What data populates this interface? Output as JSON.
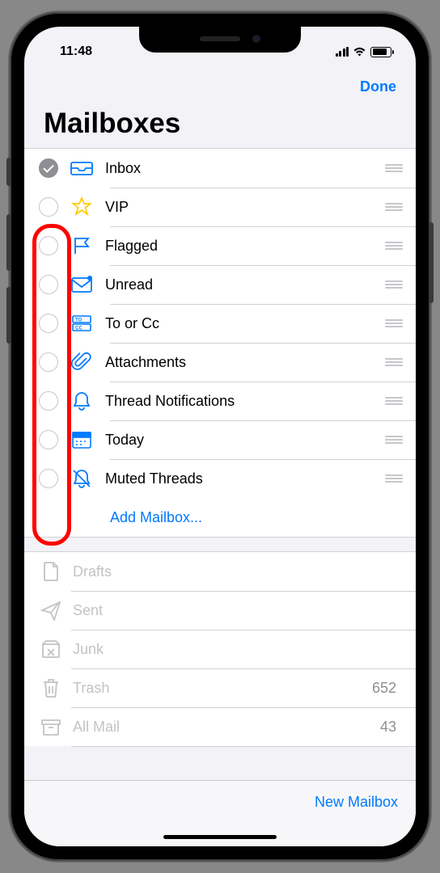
{
  "status": {
    "time": "11:48"
  },
  "nav": {
    "done": "Done"
  },
  "title": "Mailboxes",
  "smart_mailboxes": [
    {
      "id": "inbox",
      "label": "Inbox",
      "icon": "tray-icon",
      "checked": true,
      "color": "#007aff"
    },
    {
      "id": "vip",
      "label": "VIP",
      "icon": "star-icon",
      "checked": false,
      "color": "#ffcc00"
    },
    {
      "id": "flagged",
      "label": "Flagged",
      "icon": "flag-icon",
      "checked": false,
      "color": "#007aff"
    },
    {
      "id": "unread",
      "label": "Unread",
      "icon": "envelope-badge-icon",
      "checked": false,
      "color": "#007aff"
    },
    {
      "id": "tocc",
      "label": "To or Cc",
      "icon": "to-cc-icon",
      "checked": false,
      "color": "#007aff"
    },
    {
      "id": "attachments",
      "label": "Attachments",
      "icon": "paperclip-icon",
      "checked": false,
      "color": "#007aff"
    },
    {
      "id": "thread",
      "label": "Thread Notifications",
      "icon": "bell-icon",
      "checked": false,
      "color": "#007aff"
    },
    {
      "id": "today",
      "label": "Today",
      "icon": "calendar-icon",
      "checked": false,
      "color": "#007aff"
    },
    {
      "id": "muted",
      "label": "Muted Threads",
      "icon": "bell-slash-icon",
      "checked": false,
      "color": "#007aff"
    }
  ],
  "add_mailbox": "Add Mailbox...",
  "account_mailboxes": [
    {
      "id": "drafts",
      "label": "Drafts",
      "icon": "doc-icon",
      "count": ""
    },
    {
      "id": "sent",
      "label": "Sent",
      "icon": "paperplane-icon",
      "count": ""
    },
    {
      "id": "junk",
      "label": "Junk",
      "icon": "junk-icon",
      "count": ""
    },
    {
      "id": "trash",
      "label": "Trash",
      "icon": "trash-icon",
      "count": "652"
    },
    {
      "id": "allmail",
      "label": "All Mail",
      "icon": "archivebox-icon",
      "count": "43"
    }
  ],
  "toolbar": {
    "new_mailbox": "New Mailbox"
  }
}
